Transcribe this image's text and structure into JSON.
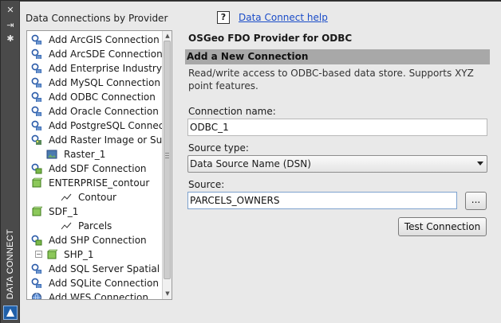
{
  "sidebar_strip": {
    "title": "DATA CONNECT",
    "close_glyph": "✕",
    "pin_glyph": "⇥",
    "settings_glyph": "✱"
  },
  "left_panel": {
    "title": "Data Connections by Provider",
    "tree": [
      {
        "label": "Add ArcGIS Connection",
        "icon": "db-connection-icon"
      },
      {
        "label": "Add ArcSDE Connection",
        "icon": "db-connection-icon"
      },
      {
        "label": "Add Enterprise Industry Mo",
        "icon": "db-connection-icon"
      },
      {
        "label": "Add MySQL Connection",
        "icon": "db-connection-icon"
      },
      {
        "label": "Add ODBC Connection",
        "icon": "db-connection-icon"
      },
      {
        "label": "Add Oracle Connection",
        "icon": "db-connection-icon"
      },
      {
        "label": "Add PostgreSQL Connectio",
        "icon": "db-connection-icon"
      },
      {
        "label": "Add Raster Image or Surfac",
        "icon": "raster-connection-icon"
      },
      {
        "label": "Raster_1",
        "icon": "raster-image-icon"
      },
      {
        "label": "Add SDF Connection",
        "icon": "file-connection-icon"
      },
      {
        "label": "ENTERPRISE_contour",
        "icon": "green-cube-icon"
      },
      {
        "label": "Contour",
        "icon": "line-feature-icon"
      },
      {
        "label": "SDF_1",
        "icon": "green-cube-icon"
      },
      {
        "label": "Parcels",
        "icon": "line-feature-icon"
      },
      {
        "label": "Add SHP Connection",
        "icon": "file-connection-icon"
      },
      {
        "label": "SHP_1",
        "icon": "green-cube-icon"
      },
      {
        "label": "Add SQL Server Spatial Con",
        "icon": "db-connection-icon"
      },
      {
        "label": "Add SQLite Connection",
        "icon": "db-connection-icon"
      },
      {
        "label": "Add WFS Connection",
        "icon": "globe-icon"
      }
    ]
  },
  "right_panel": {
    "help_glyph": "?",
    "help_link": "Data Connect help",
    "provider_title": "OSGeo FDO Provider for ODBC",
    "section_title": "Add a New Connection",
    "description": "Read/write access to ODBC-based data store. Supports XYZ point features.",
    "connection_name_label": "Connection name:",
    "connection_name_value": "ODBC_1",
    "source_type_label": "Source type:",
    "source_type_value": "Data Source Name (DSN)",
    "source_label": "Source:",
    "source_value": "PARCELS_OWNERS",
    "browse_label": "...",
    "test_button": "Test Connection"
  },
  "colors": {
    "panel_bg": "#e9e9e9",
    "strip_bg": "#4a4a4a",
    "section_bg": "#a8a8a8",
    "link": "#1a4cc8"
  }
}
